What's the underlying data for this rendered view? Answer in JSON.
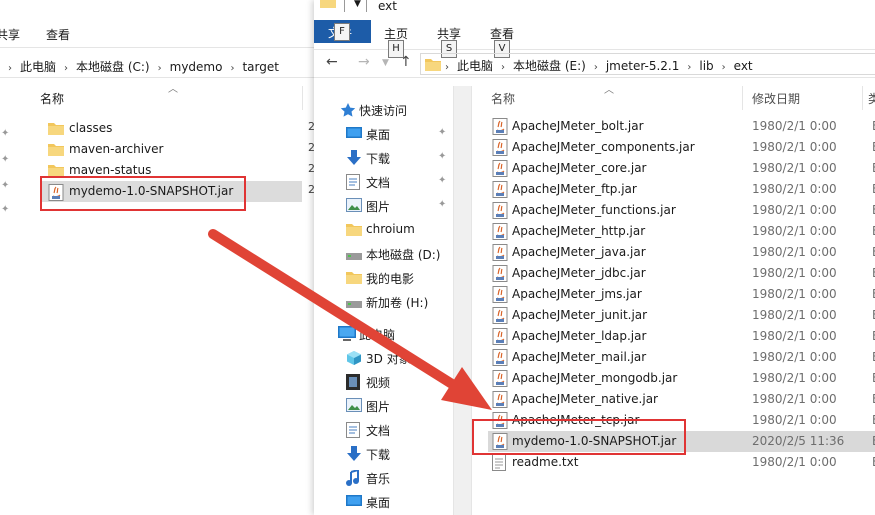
{
  "left_window": {
    "ribbon_tabs": [
      "共享",
      "查看"
    ],
    "breadcrumb": [
      "此电脑",
      "本地磁盘 (C:)",
      "mydemo",
      "target"
    ],
    "column_name": "名称",
    "items": [
      {
        "name": "classes",
        "type": "folder",
        "edge": "2"
      },
      {
        "name": "maven-archiver",
        "type": "folder",
        "edge": "2"
      },
      {
        "name": "maven-status",
        "type": "folder",
        "edge": "2"
      },
      {
        "name": "mydemo-1.0-SNAPSHOT.jar",
        "type": "jar",
        "edge": "2"
      }
    ]
  },
  "right_window": {
    "title": "ext",
    "file_tab": "文件",
    "file_tab_keytip": "F",
    "ribbon_tabs": [
      {
        "label": "主页",
        "keytip": "H"
      },
      {
        "label": "共享",
        "keytip": "S"
      },
      {
        "label": "查看",
        "keytip": "V"
      }
    ],
    "breadcrumb": [
      "此电脑",
      "本地磁盘 (E:)",
      "jmeter-5.2.1",
      "lib",
      "ext"
    ],
    "nav_pane": [
      {
        "label": "快速访问",
        "icon": "star-icon",
        "pinned": false
      },
      {
        "label": "桌面",
        "icon": "desktop-icon",
        "pinned": true
      },
      {
        "label": "下载",
        "icon": "download-icon",
        "pinned": true
      },
      {
        "label": "文档",
        "icon": "document-icon",
        "pinned": true
      },
      {
        "label": "图片",
        "icon": "picture-icon",
        "pinned": true
      },
      {
        "label": "chroium",
        "icon": "folder-icon",
        "pinned": false
      },
      {
        "label": "本地磁盘 (D:)",
        "icon": "drive-icon",
        "pinned": false
      },
      {
        "label": "我的电影",
        "icon": "folder-icon",
        "pinned": false
      },
      {
        "label": "新加卷 (H:)",
        "icon": "drive-icon",
        "pinned": false
      },
      {
        "label": "此电脑",
        "icon": "computer-icon",
        "pinned": false
      },
      {
        "label": "3D 对象",
        "icon": "cube-icon",
        "pinned": false
      },
      {
        "label": "视频",
        "icon": "video-icon",
        "pinned": false
      },
      {
        "label": "图片",
        "icon": "picture-icon",
        "pinned": false
      },
      {
        "label": "文档",
        "icon": "document-icon",
        "pinned": false
      },
      {
        "label": "下载",
        "icon": "download-icon",
        "pinned": false
      },
      {
        "label": "音乐",
        "icon": "music-icon",
        "pinned": false
      },
      {
        "label": "桌面",
        "icon": "desktop-icon",
        "pinned": false
      }
    ],
    "columns": {
      "name": "名称",
      "modified": "修改日期",
      "type": "类"
    },
    "files": [
      {
        "name": "ApacheJMeter_bolt.jar",
        "modified": "1980/2/1 0:00",
        "type": "E"
      },
      {
        "name": "ApacheJMeter_components.jar",
        "modified": "1980/2/1 0:00",
        "type": "E"
      },
      {
        "name": "ApacheJMeter_core.jar",
        "modified": "1980/2/1 0:00",
        "type": "E"
      },
      {
        "name": "ApacheJMeter_ftp.jar",
        "modified": "1980/2/1 0:00",
        "type": "E"
      },
      {
        "name": "ApacheJMeter_functions.jar",
        "modified": "1980/2/1 0:00",
        "type": "E"
      },
      {
        "name": "ApacheJMeter_http.jar",
        "modified": "1980/2/1 0:00",
        "type": "E"
      },
      {
        "name": "ApacheJMeter_java.jar",
        "modified": "1980/2/1 0:00",
        "type": "E"
      },
      {
        "name": "ApacheJMeter_jdbc.jar",
        "modified": "1980/2/1 0:00",
        "type": "E"
      },
      {
        "name": "ApacheJMeter_jms.jar",
        "modified": "1980/2/1 0:00",
        "type": "E"
      },
      {
        "name": "ApacheJMeter_junit.jar",
        "modified": "1980/2/1 0:00",
        "type": "E"
      },
      {
        "name": "ApacheJMeter_ldap.jar",
        "modified": "1980/2/1 0:00",
        "type": "E"
      },
      {
        "name": "ApacheJMeter_mail.jar",
        "modified": "1980/2/1 0:00",
        "type": "E"
      },
      {
        "name": "ApacheJMeter_mongodb.jar",
        "modified": "1980/2/1 0:00",
        "type": "E"
      },
      {
        "name": "ApacheJMeter_native.jar",
        "modified": "1980/2/1 0:00",
        "type": "E"
      },
      {
        "name": "ApacheJMeter_tcp.jar",
        "modified": "1980/2/1 0:00",
        "type": "E"
      },
      {
        "name": "mydemo-1.0-SNAPSHOT.jar",
        "modified": "2020/2/5 11:36",
        "type": "E"
      },
      {
        "name": "readme.txt",
        "modified": "1980/2/1 0:00",
        "type": "E"
      }
    ]
  },
  "colors": {
    "highlight": "#e03434",
    "arrow": "#e04436",
    "file_tab": "#1d5ca8",
    "folder": "#f2c75c"
  }
}
